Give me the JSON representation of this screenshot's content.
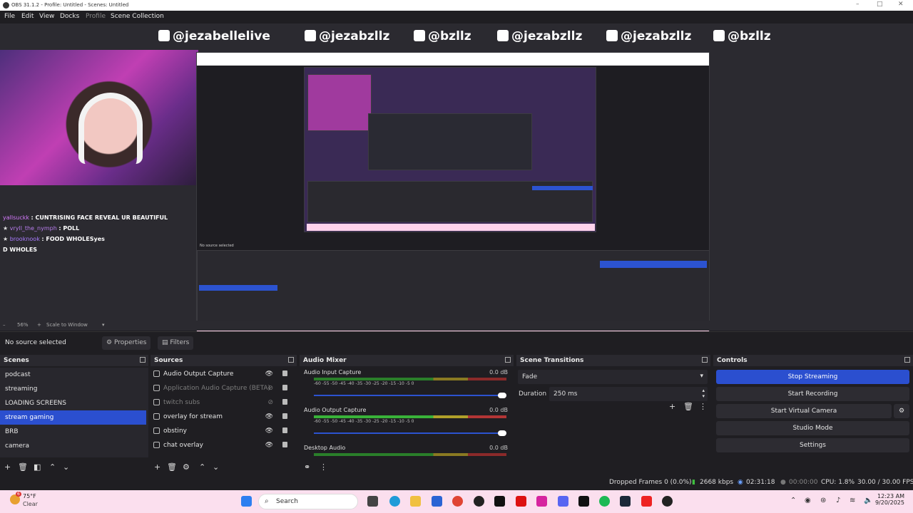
{
  "window": {
    "title": "OBS 31.1.2 - Profile: Untitled - Scenes: Untitled"
  },
  "menu": [
    "File",
    "Edit",
    "View",
    "Docks",
    "Profile",
    "Scene Collection"
  ],
  "social": [
    {
      "icon": "youtube-icon",
      "handle": "@jezabellelive"
    },
    {
      "icon": "twitch-icon",
      "handle": "@jezabzllz"
    },
    {
      "icon": "instagram-icon",
      "handle": "@bzllz"
    },
    {
      "icon": "snapchat-icon",
      "handle": "@jezabzllz"
    },
    {
      "icon": "twitter-icon",
      "handle": "@jezabzllz"
    },
    {
      "icon": "tiktok-icon",
      "handle": "@bzllz"
    }
  ],
  "chat": [
    {
      "user": "yallsuckk",
      "msg": ": CUNTRISING FACE REVEAL UR BEAUTIFUL"
    },
    {
      "user": "vryll_the_nymph",
      "msg": ": POLL"
    },
    {
      "user": "brooknook",
      "msg": ": FOOD WHOLESyes"
    },
    {
      "user": "",
      "msg": "D WHOLES"
    }
  ],
  "preview_footer": {
    "zoom": "56%",
    "scale": "Scale to Window"
  },
  "properties": {
    "no_source": "No source selected",
    "properties_label": "Properties",
    "filters_label": "Filters"
  },
  "scenes": {
    "title": "Scenes",
    "items": [
      "podcast",
      "streaming",
      "LOADING SCREENS",
      "stream gaming",
      "BRB",
      "camera"
    ],
    "selected": "stream gaming"
  },
  "sources": {
    "title": "Sources",
    "items": [
      {
        "name": "Audio Output Capture",
        "visible": true
      },
      {
        "name": "Application Audio Capture (BETA)",
        "visible": false
      },
      {
        "name": "twitch subs",
        "visible": false
      },
      {
        "name": "overlay for stream",
        "visible": true
      },
      {
        "name": "obstiny",
        "visible": true
      },
      {
        "name": "chat overlay",
        "visible": true
      }
    ]
  },
  "mixer": {
    "title": "Audio Mixer",
    "ticks": "-60  -55  -50  -45  -40  -35  -30  -25  -20  -15  -10   -5    0",
    "channels": [
      {
        "name": "Audio Input Capture",
        "db": "0.0 dB"
      },
      {
        "name": "Audio Output Capture",
        "db": "0.0 dB"
      },
      {
        "name": "Desktop Audio",
        "db": "0.0 dB"
      }
    ]
  },
  "transitions": {
    "title": "Scene Transitions",
    "type": "Fade",
    "duration_label": "Duration",
    "duration": "250 ms"
  },
  "controls": {
    "title": "Controls",
    "buttons": [
      "Stop Streaming",
      "Start Recording",
      "Start Virtual Camera",
      "Studio Mode",
      "Settings"
    ]
  },
  "status": {
    "dropped": "Dropped Frames 0 (0.0%)",
    "kbps": "2668 kbps",
    "stream_time": "02:31:18",
    "rec_time": "00:00:00",
    "cpu": "CPU: 1.8%",
    "fps": "30.00 / 30.00 FPS"
  },
  "taskbar": {
    "temp": "75°F",
    "cond": "Clear",
    "search": "Search",
    "time": "12:23 AM",
    "date": "9/20/2025",
    "badge": "6",
    "apps": [
      "windows-icon",
      "task-view-icon",
      "edge-icon",
      "file-explorer-icon",
      "chrome-icon",
      "obs-icon",
      "capcut-icon",
      "netflix-icon",
      "instagram-icon",
      "discord-icon",
      "tiktok-icon",
      "spotify-icon",
      "steam-icon",
      "roblox-icon",
      "obs-app-icon"
    ],
    "accent": "#fbdfee"
  },
  "colors": {
    "selection": "#2b4fcf",
    "panel": "#1f1e22",
    "panel_alt": "#28272d"
  }
}
